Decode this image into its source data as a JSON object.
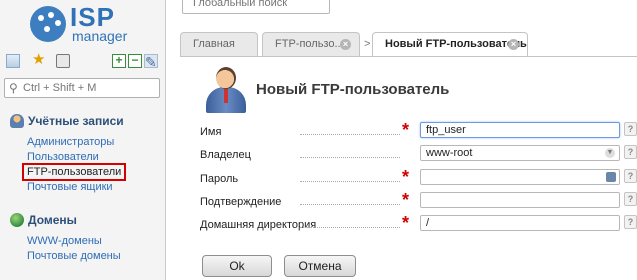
{
  "logo": {
    "brand": "ISP",
    "sub": "manager"
  },
  "sidebar": {
    "search_placeholder": "Ctrl + Shift + M",
    "groups": [
      {
        "title": "Учётные записи",
        "icon": "users-icon",
        "items": [
          {
            "label": "Администраторы"
          },
          {
            "label": "Пользователи"
          },
          {
            "label": "FTP-пользователи",
            "active": true
          },
          {
            "label": "Почтовые ящики"
          }
        ]
      },
      {
        "title": "Домены",
        "icon": "globe-icon",
        "items": [
          {
            "label": "WWW-домены"
          },
          {
            "label": "Почтовые домены"
          }
        ]
      }
    ]
  },
  "top_search": {
    "placeholder": "Глобальный поиск"
  },
  "tabs": [
    {
      "label": "Главная"
    },
    {
      "label": "FTP-пользо..."
    },
    {
      "label": "Новый FTP-пользователь",
      "active": true
    }
  ],
  "tab_separator": ">",
  "form": {
    "title": "Новый FTP-пользователь",
    "fields": [
      {
        "label": "Имя",
        "value": "ftp_user",
        "required": true
      },
      {
        "label": "Владелец",
        "value": "www-root",
        "required": false
      },
      {
        "label": "Пароль",
        "value": "",
        "required": true
      },
      {
        "label": "Подтверждение",
        "value": "",
        "required": true
      },
      {
        "label": "Домашняя директория",
        "value": "/",
        "required": true
      }
    ],
    "help_glyph": "?",
    "required_glyph": "*",
    "ok_label": "Ok",
    "cancel_label": "Отмена"
  },
  "colors": {
    "accent": "#2f72b8",
    "required": "#d40000",
    "active_nav_border": "#d40000"
  }
}
